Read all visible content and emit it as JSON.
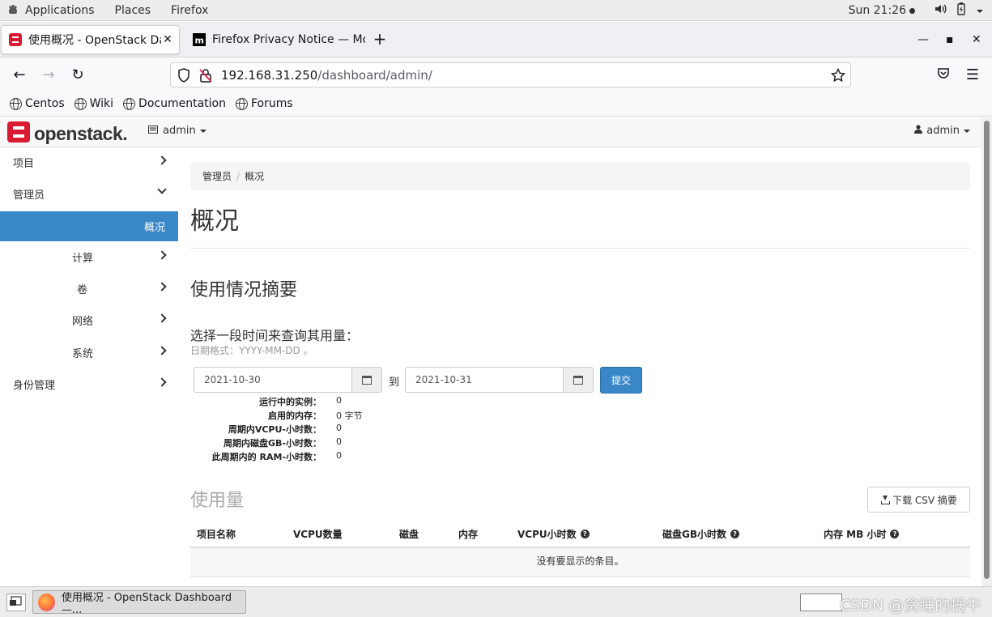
{
  "topbar": {
    "applications": "Applications",
    "places": "Places",
    "firefox": "Firefox",
    "clock": "Sun 21:26"
  },
  "tabs": [
    {
      "title": "使用概况 - OpenStack Dashboard",
      "active": true
    },
    {
      "title": "Firefox Privacy Notice — Mozilla",
      "active": false
    }
  ],
  "url": {
    "host": "192.168.31.250",
    "path": "/dashboard/admin/"
  },
  "bookmarks": [
    "Centos",
    "Wiki",
    "Documentation",
    "Forums"
  ],
  "header": {
    "logo_text": "openstack.",
    "project": "admin",
    "user": "admin"
  },
  "sidebar": {
    "items": [
      {
        "label": "项目"
      },
      {
        "label": "管理员"
      },
      {
        "label": "概况"
      },
      {
        "label": "计算"
      },
      {
        "label": "卷"
      },
      {
        "label": "网络"
      },
      {
        "label": "系统"
      },
      {
        "label": "身份管理"
      }
    ]
  },
  "breadcrumb": [
    "管理员",
    "概况"
  ],
  "page_title": "概况",
  "summary": {
    "title": "使用情况摘要",
    "range_label": "选择一段时间来查询其用量：",
    "range_help": "日期格式：YYYY-MM-DD 。",
    "start_date": "2021-10-30",
    "to_label": "到",
    "end_date": "2021-10-31",
    "submit": "提交",
    "stats": [
      {
        "label": "运行中的实例：",
        "value": "0"
      },
      {
        "label": "启用的内存：",
        "value": "0 字节"
      },
      {
        "label": "周期内VCPU-小时数：",
        "value": "0"
      },
      {
        "label": "周期内磁盘GB-小时数：",
        "value": "0"
      },
      {
        "label": "此周期内的 RAM-小时数：",
        "value": "0"
      }
    ]
  },
  "usage": {
    "title": "使用量",
    "csv_button": "下载 CSV 摘要",
    "columns": [
      "项目名称",
      "VCPU数量",
      "磁盘",
      "内存",
      "VCPU小时数",
      "磁盘GB小时数",
      "内存 MB 小时"
    ],
    "empty_text": "没有要显示的条目。"
  },
  "taskbar": {
    "window_title": "使用概况 - OpenStack Dashboard —..."
  },
  "watermark": "CSDN @贪睡的蜗牛",
  "colors": {
    "accent": "#3a87c8",
    "logo_red": "#da1a32"
  }
}
